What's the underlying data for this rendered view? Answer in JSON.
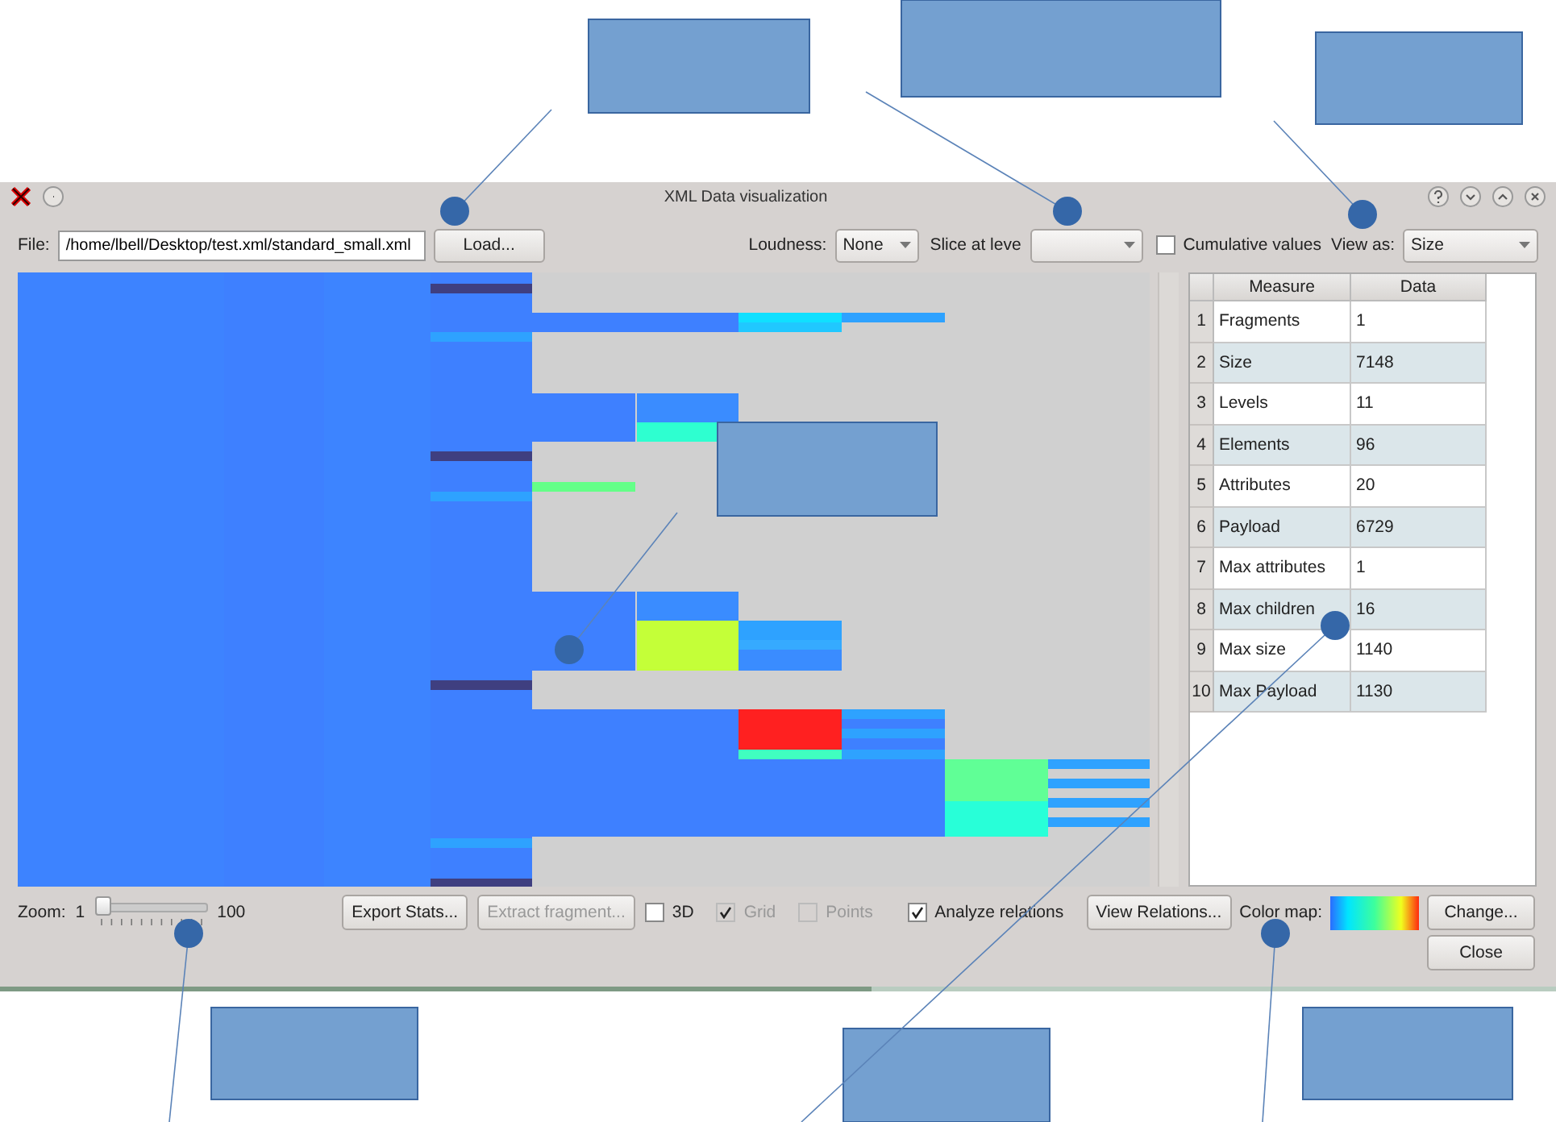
{
  "window": {
    "title": "XML Data visualization"
  },
  "toolbar": {
    "file_label": "File:",
    "file_path": "/home/lbell/Desktop/test.xml/standard_small.xml",
    "load_button": "Load...",
    "loudness_label": "Loudness:",
    "loudness_value": "None",
    "slice_label": "Slice at leve",
    "cumulative": {
      "label": "Cumulative values",
      "checked": false
    },
    "view_as_label": "View as:",
    "view_as_value": "Size"
  },
  "table": {
    "columns": [
      "Measure",
      "Data"
    ],
    "rows": [
      {
        "index": "1",
        "measure": "Fragments",
        "data": "1"
      },
      {
        "index": "2",
        "measure": "Size",
        "data": "7148"
      },
      {
        "index": "3",
        "measure": "Levels",
        "data": "11"
      },
      {
        "index": "4",
        "measure": "Elements",
        "data": "96"
      },
      {
        "index": "5",
        "measure": "Attributes",
        "data": "20"
      },
      {
        "index": "6",
        "measure": "Payload",
        "data": "6729"
      },
      {
        "index": "7",
        "measure": "Max attributes",
        "data": "1"
      },
      {
        "index": "8",
        "measure": "Max children",
        "data": "16"
      },
      {
        "index": "9",
        "measure": "Max size",
        "data": "1140"
      },
      {
        "index": "10",
        "measure": "Max Payload",
        "data": "1130"
      }
    ]
  },
  "zoom": {
    "label": "Zoom:",
    "min": "1",
    "max": "100",
    "level": 0
  },
  "buttons": [
    {
      "label": "Export Stats...",
      "disabled": false
    },
    {
      "label": "Extract fragment...",
      "disabled": true
    }
  ],
  "options": [
    {
      "label": "3D",
      "checked": false,
      "disabled": false
    },
    {
      "label": "Grid",
      "checked": true,
      "disabled": true
    },
    {
      "label": "Points",
      "checked": false,
      "disabled": true
    }
  ],
  "relations": {
    "analyze": {
      "label": "Analyze relations",
      "checked": true
    },
    "view_button": "View Relations..."
  },
  "color_map": {
    "label": "Color map:"
  },
  "change_button": "Change...",
  "close_button": "Close"
}
